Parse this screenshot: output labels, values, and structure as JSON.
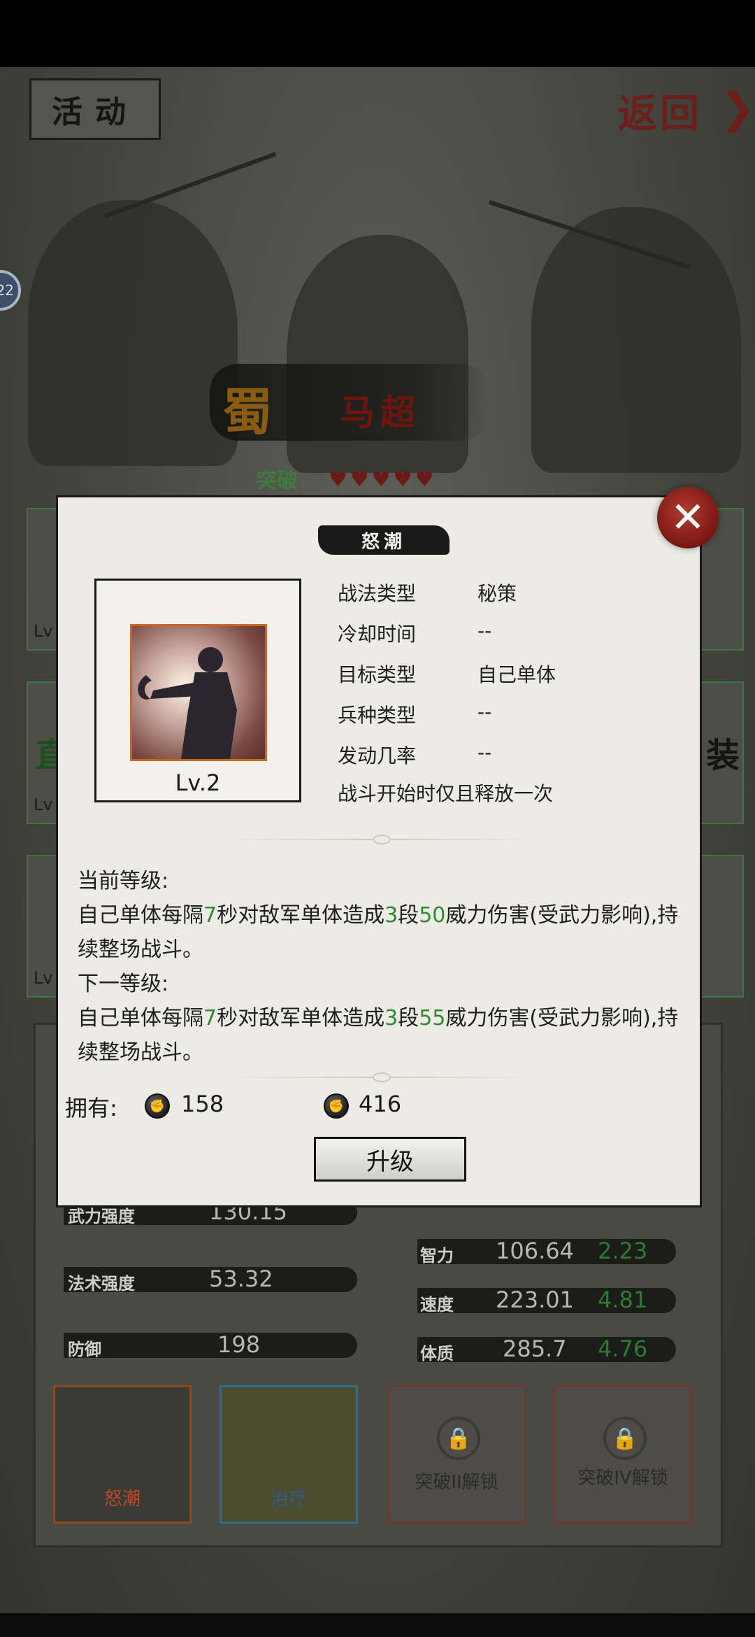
{
  "header": {
    "activity_label": "活动",
    "return_label": "返回",
    "return_arrow": "❯",
    "side_badge": "22"
  },
  "hero": {
    "faction": "蜀",
    "name": "马超",
    "breakthrough": "突破",
    "stars": "♥♥♥♥♥"
  },
  "side": {
    "lv": "Lv",
    "equip_char": "装",
    "zhen_char": "直"
  },
  "skill_modal": {
    "title": "怒潮",
    "close_glyph": "✕",
    "level": "Lv.2",
    "info": [
      {
        "label": "战法类型",
        "value": "秘策"
      },
      {
        "label": "冷却时间",
        "value": "--"
      },
      {
        "label": "目标类型",
        "value": "自己单体"
      },
      {
        "label": "兵种类型",
        "value": "--"
      },
      {
        "label": "发动几率",
        "value": "--"
      }
    ],
    "battle_note": "战斗开始时仅且释放一次",
    "current_label": "当前等级:",
    "current_desc": {
      "p1": "自己单体每隔",
      "n1": "7",
      "p2": "秒对敌军单体造成",
      "n2": "3",
      "p3": "段",
      "n3": "50",
      "p4": "威力伤害(受武力影响),持续整场战斗。"
    },
    "next_label": "下一等级:",
    "next_desc": {
      "p1": "自己单体每隔",
      "n1": "7",
      "p2": "秒对敌军单体造成",
      "n2": "3",
      "p3": "段",
      "n3": "55",
      "p4": "威力伤害(受武力影响),持续整场战斗。"
    },
    "own_label": "拥有:",
    "owned": "158",
    "required": "416",
    "upgrade_label": "升级"
  },
  "stats": {
    "left": [
      {
        "label": "武力强度",
        "value": "130.15"
      },
      {
        "label": "法术强度",
        "value": "53.32"
      },
      {
        "label": "防御",
        "value": "198"
      }
    ],
    "right": [
      {
        "label": "智力",
        "value": "106.64",
        "add": "2.23"
      },
      {
        "label": "速度",
        "value": "223.01",
        "add": "4.81"
      },
      {
        "label": "体质",
        "value": "285.7",
        "add": "4.76"
      }
    ]
  },
  "skills": [
    {
      "label": "怒潮",
      "state": "active"
    },
    {
      "label": "治疗",
      "state": "active"
    },
    {
      "label": "突破II解锁",
      "state": "locked"
    },
    {
      "label": "突破IV解锁",
      "state": "locked"
    }
  ]
}
